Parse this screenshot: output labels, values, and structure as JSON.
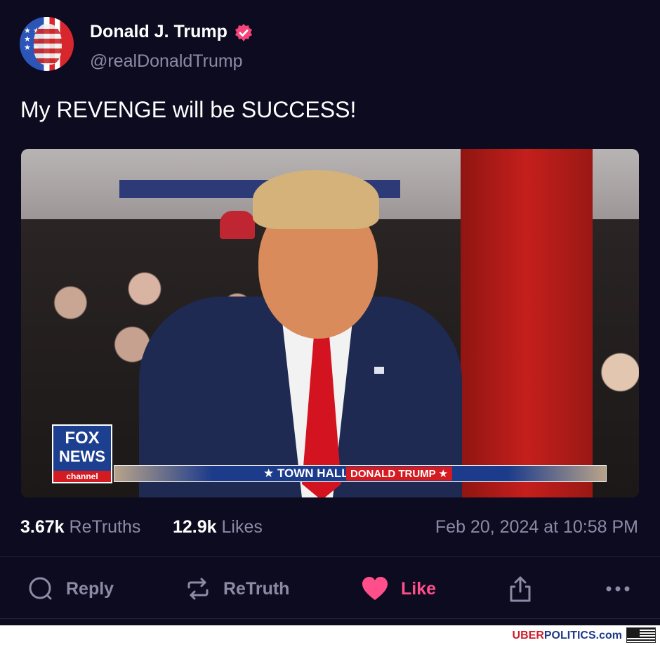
{
  "author": {
    "display_name": "Donald J. Trump",
    "handle": "@realDonaldTrump",
    "verified_badge_color": "#f5447b"
  },
  "post": {
    "text": "My REVENGE will be SUCCESS!",
    "media": {
      "network_logo_line1": "FOX",
      "network_logo_line2": "NEWS",
      "network_logo_line3": "channel",
      "lower_third_text": "★ TOWN HALL",
      "lower_third_name": "DONALD TRUMP ★"
    }
  },
  "stats": {
    "retruths_count": "3.67k",
    "retruths_label": "ReTruths",
    "likes_count": "12.9k",
    "likes_label": "Likes",
    "timestamp": "Feb 20, 2024 at 10:58 PM"
  },
  "actions": {
    "reply_label": "Reply",
    "retruth_label": "ReTruth",
    "like_label": "Like",
    "like_color": "#ff4f8b"
  },
  "watermark": {
    "brand_part1": "UBER",
    "brand_part2": "POLITICS",
    "brand_part3": ".com"
  },
  "colors": {
    "background": "#0d0b1f",
    "muted_text": "#8d8aa6"
  }
}
